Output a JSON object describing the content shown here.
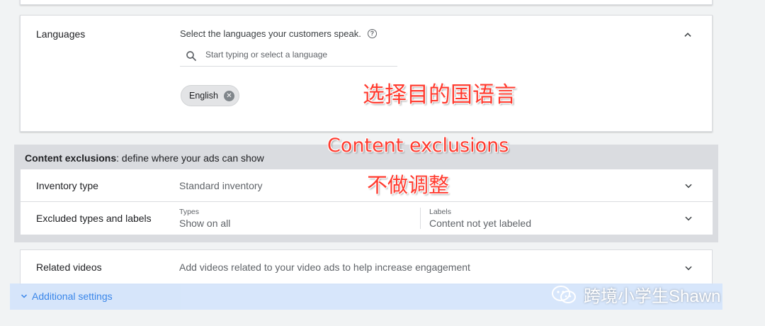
{
  "languages": {
    "label": "Languages",
    "prompt": "Select the languages your customers speak.",
    "search_placeholder": "Start typing or select a language",
    "selected_chip": "English",
    "help_glyph": "?"
  },
  "content_exclusions": {
    "title_bold": "Content exclusions",
    "title_rest": ": define where your ads can show",
    "inventory_type": {
      "label": "Inventory type",
      "value": "Standard inventory"
    },
    "excluded_types": {
      "label": "Excluded types and labels",
      "types_label": "Types",
      "types_value": "Show on all",
      "labels_label": "Labels",
      "labels_value": "Content not yet labeled"
    }
  },
  "related_videos": {
    "label": "Related videos",
    "description": "Add videos related to your video ads to help increase engagement"
  },
  "additional_settings": {
    "label": "Additional settings"
  },
  "annotations": {
    "note_languages": "选择目的国语言",
    "note_exclusions_title": "Content exclusions",
    "note_exclusions_body": "不做调整"
  },
  "watermark": {
    "text": "跨境小学生Shawn"
  },
  "colors": {
    "accent": "#1a73e8",
    "annotation": "#ff3b2f",
    "panel_gray": "#dadce0",
    "highlight": "#d2e3fc"
  }
}
